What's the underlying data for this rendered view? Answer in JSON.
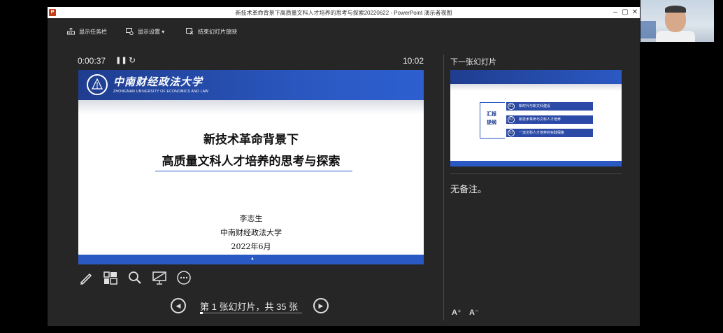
{
  "window": {
    "title": "新技术革命背景下高质量文科人才培养的思考与探索20220622 - PowerPoint 演示者视图",
    "app_icon": "P",
    "controls": {
      "minimize": "–",
      "restore": "▢",
      "close": "✕"
    }
  },
  "toolbar": {
    "show_taskbar": "显示任务栏",
    "display_settings": "显示设置 ▾",
    "end_show": "结束幻灯片放映"
  },
  "presenter": {
    "elapsed_time": "0:00:37",
    "pause_symbol": "❚❚",
    "restart_symbol": "↻",
    "clock": "10:02"
  },
  "current_slide": {
    "logo_text": "中南财经政法大学",
    "logo_sub": "ZHONGNAN UNIVERSITY OF ECONOMICS AND LAW",
    "title_line1": "新技术革命背景下",
    "title_line2": "高质量文科人才培养的思考与探索",
    "author": "李志生",
    "institution": "中南财经政法大学",
    "date": "2022年6月",
    "footer_mark": "▲"
  },
  "navigation": {
    "prev_symbol": "◀",
    "next_symbol": "▶",
    "slide_counter": "第 1 张幻灯片，共 35 张",
    "progress": 0.0286
  },
  "next_slide": {
    "label": "下一张幻灯片",
    "heading": "汇报提纲",
    "items": [
      {
        "num": "01",
        "text": "新时代与新文科建设"
      },
      {
        "num": "02",
        "text": "新技术革命与文科人才培养"
      },
      {
        "num": "03",
        "text": "一流文科人才培养的实践探索"
      }
    ]
  },
  "notes": {
    "text": "无备注。"
  },
  "font_controls": {
    "increase": "A⁺",
    "decrease": "A⁻"
  },
  "colors": {
    "accent_blue": "#2b59c3",
    "bg": "#262626"
  }
}
